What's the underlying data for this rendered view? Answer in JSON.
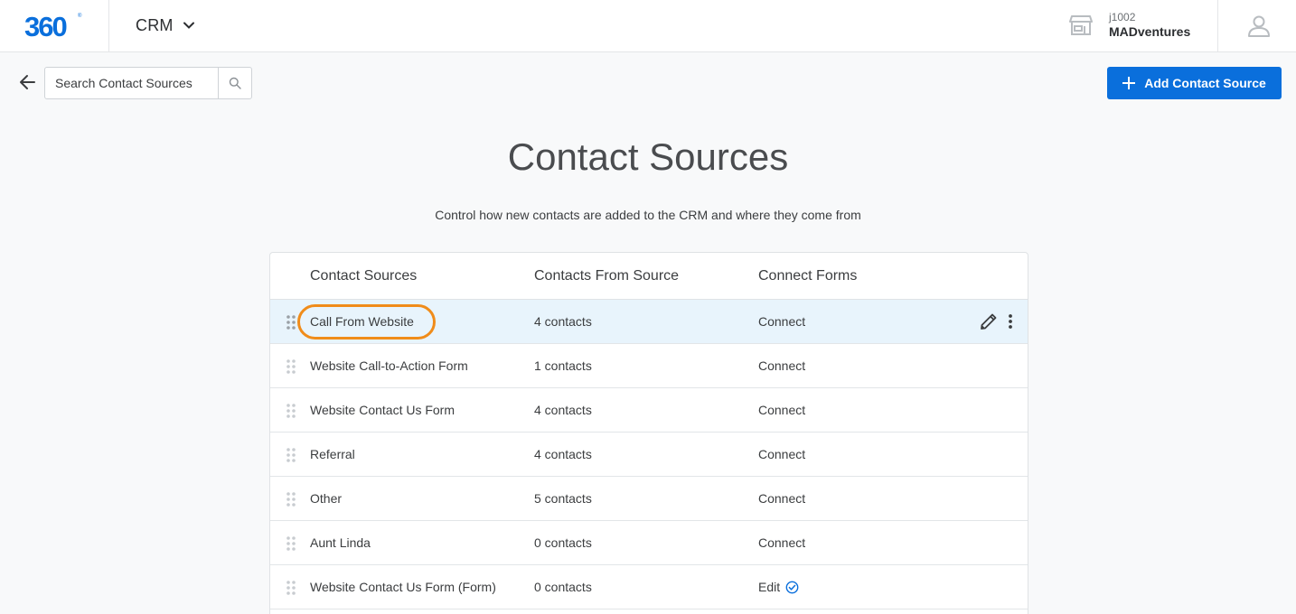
{
  "header": {
    "logo_text": "360",
    "app_name": "CRM",
    "account_id": "j1002",
    "account_name": "MADventures"
  },
  "toolbar": {
    "search_placeholder": "Search Contact Sources",
    "add_button_label": "Add Contact Source"
  },
  "page": {
    "title": "Contact Sources",
    "subtitle": "Control how new contacts are added to the CRM and where they come from"
  },
  "table": {
    "columns": [
      "Contact Sources",
      "Contacts From Source",
      "Connect Forms"
    ],
    "rows": [
      {
        "name": "Call From Website",
        "contacts": "4 contacts",
        "action": "Connect"
      },
      {
        "name": "Website Call-to-Action Form",
        "contacts": "1 contacts",
        "action": "Connect"
      },
      {
        "name": "Website Contact Us Form",
        "contacts": "4 contacts",
        "action": "Connect"
      },
      {
        "name": "Referral",
        "contacts": "4 contacts",
        "action": "Connect"
      },
      {
        "name": "Other",
        "contacts": "5 contacts",
        "action": "Connect"
      },
      {
        "name": "Aunt Linda",
        "contacts": "0 contacts",
        "action": "Connect"
      },
      {
        "name": "Website Contact Us Form (Form)",
        "contacts": "0 contacts",
        "action": "Edit"
      }
    ]
  },
  "colors": {
    "accent": "#0a6fdc",
    "highlight": "#f08c1a",
    "selected_row": "#e8f4fc"
  },
  "icons": {
    "back": "arrow-left-icon",
    "search": "search-icon",
    "add": "plus-icon",
    "store": "store-icon",
    "user": "user-icon",
    "drag": "drag-handle-icon",
    "edit": "pencil-icon",
    "more": "kebab-icon",
    "connected": "check-circle-icon"
  }
}
